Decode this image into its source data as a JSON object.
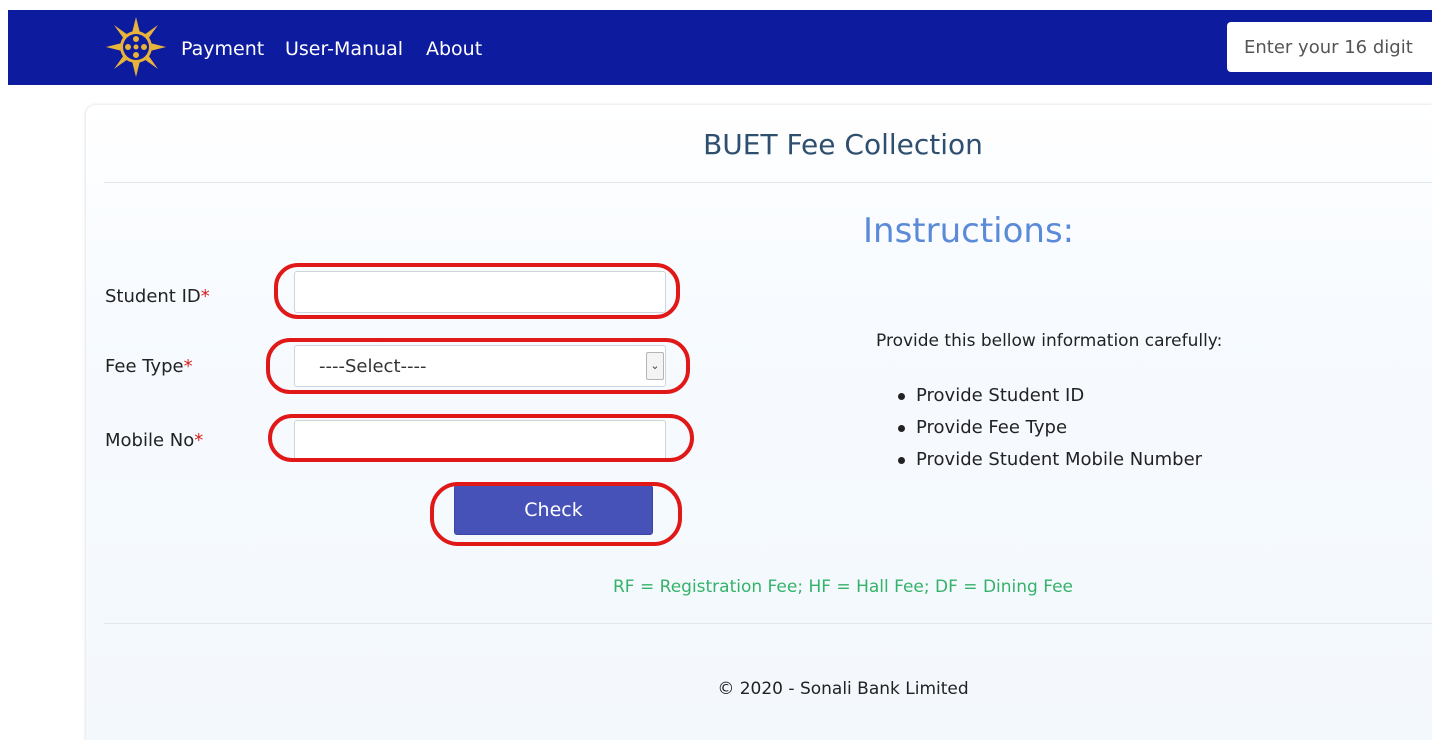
{
  "navbar": {
    "logo_icon": "sun-emblem-icon",
    "links": [
      {
        "label": "Payment"
      },
      {
        "label": "User-Manual"
      },
      {
        "label": "About"
      }
    ],
    "search_placeholder": "Enter your 16 digit",
    "background_color": "#0d1b9e"
  },
  "main": {
    "title": "BUET Fee Collection",
    "form": {
      "student_id": {
        "label": "Student ID",
        "required_mark": "*",
        "value": ""
      },
      "fee_type": {
        "label": "Fee Type",
        "required_mark": "*",
        "selected": "----Select----"
      },
      "mobile_no": {
        "label": "Mobile No",
        "required_mark": "*",
        "value": ""
      },
      "check_button": {
        "label": "Check",
        "color": "#4652b8"
      }
    },
    "instructions": {
      "title": "Instructions:",
      "intro": "Provide this bellow information carefully:",
      "items": [
        "Provide Student ID",
        "Provide Fee Type",
        "Provide Student Mobile Number"
      ]
    },
    "fee_legend": "RF = Registration Fee; HF = Hall Fee; DF = Dining Fee",
    "highlight_color": "#e01818"
  },
  "footer": {
    "text": "© 2020 - Sonali Bank Limited"
  }
}
